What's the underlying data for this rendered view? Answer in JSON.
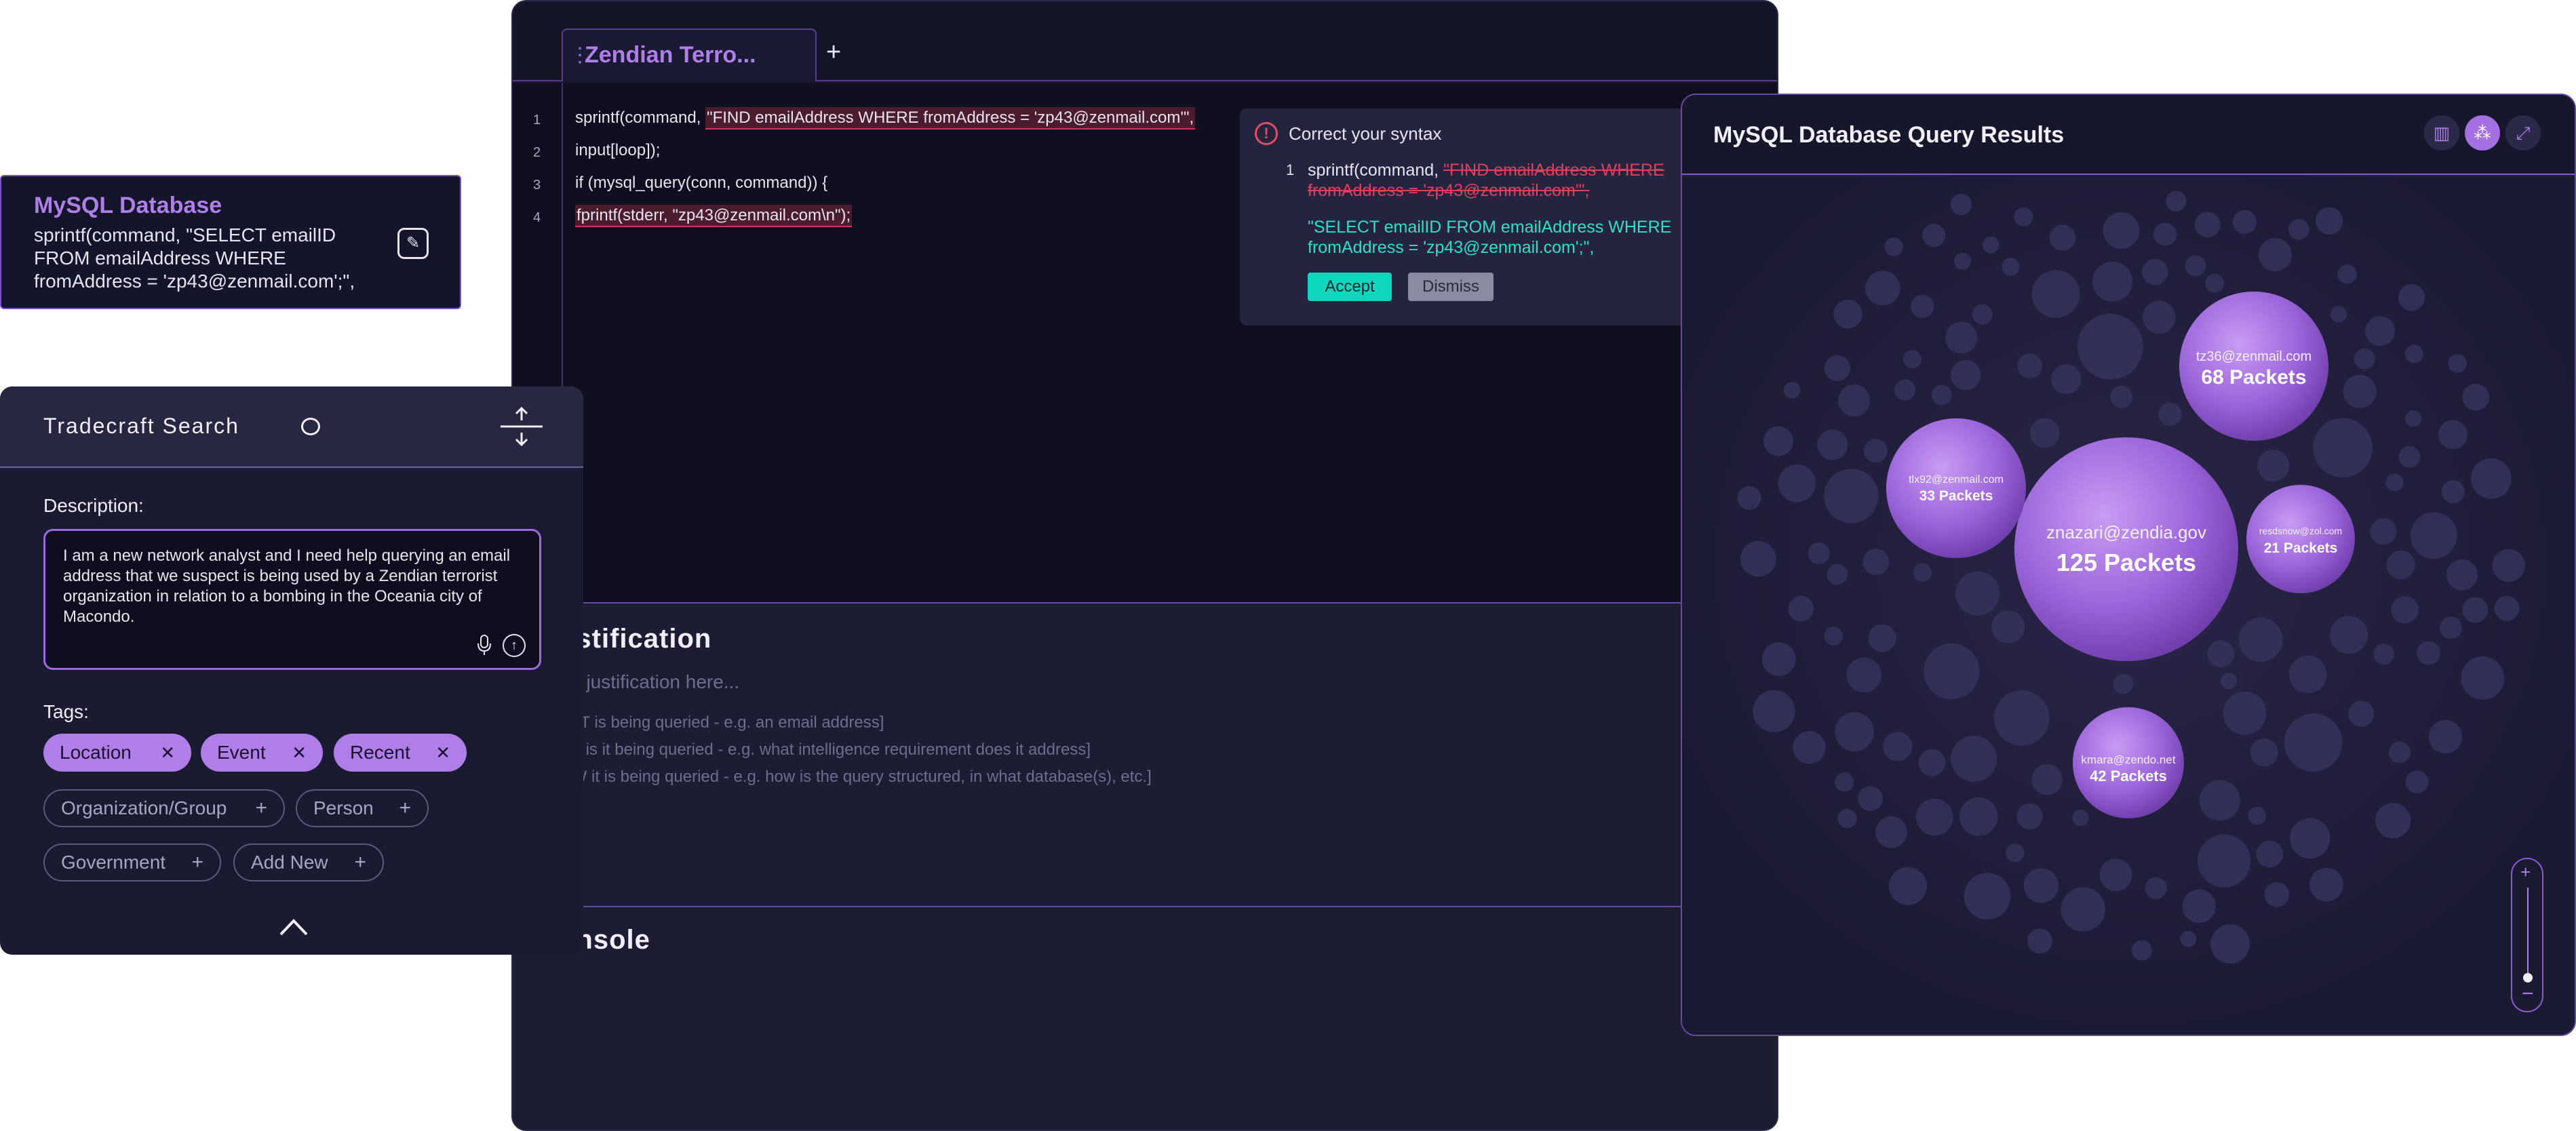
{
  "editor": {
    "tab_title": "Zendian Terro...",
    "add_tab": "+",
    "lines": [
      {
        "no": "1",
        "plain": "sprintf(command, ",
        "error": "\"FIND emailAddress WHERE fromAddress = 'zp43@zenmail.com'\","
      },
      {
        "no": "2",
        "plain": "input[loop]);",
        "error": ""
      },
      {
        "no": "3",
        "plain": "if (mysql_query(conn, command)) {",
        "error": ""
      },
      {
        "no": "4",
        "plain": "",
        "error": "fprintf(stderr, \"zp43@zenmail.com\\n\");"
      }
    ],
    "suggestion": {
      "title": "Correct your syntax",
      "line_no": "1",
      "line_prefix": "sprintf(command, ",
      "removed": "\"FIND emailAddress WHERE fromAddress = 'zp43@zenmail.com'\",",
      "added": "\"SELECT emailID FROM emailAddress WHERE fromAddress = 'zp43@zenmail.com';\",",
      "accept_label": "Accept",
      "dismiss_label": "Dismiss"
    },
    "justification": {
      "heading": "ustification",
      "placeholder": "ter justification here...",
      "hints": [
        "HAT is being queried - e.g. an email address]",
        "HY is it being queried - e.g. what intelligence requirement does it address]",
        "OW it is being queried - e.g. how is the query structured, in what database(s), etc.]"
      ]
    },
    "console_heading": "onsole"
  },
  "db_card": {
    "title": "MySQL Database",
    "query": "sprintf(command, \"SELECT emailID FROM emailAddress WHERE fromAddress = 'zp43@zenmail.com';\","
  },
  "search": {
    "title": "Tradecraft Search",
    "description_label": "Description:",
    "description": "I am a new network analyst and I need help querying an email address that we suspect is being used by a Zendian terrorist organization in relation to a bombing in the Oceania city of Macondo.",
    "tags_label": "Tags:",
    "selected_tags": [
      "Location",
      "Event",
      "Recent"
    ],
    "suggested_tags": [
      "Organization/Group",
      "Person",
      "Government",
      "Add New"
    ]
  },
  "results": {
    "title": "MySQL Database Query Results",
    "icons": [
      "bar-chart-icon",
      "bubble-chart-icon",
      "expand-icon"
    ],
    "bubbles": [
      {
        "email": "znazari@zendia.gov",
        "packets": "125 Packets"
      },
      {
        "email": "tz36@zenmail.com",
        "packets": "68 Packets"
      },
      {
        "email": "kmara@zendo.net",
        "packets": "42 Packets"
      },
      {
        "email": "tlx92@zenmail.com",
        "packets": "33 Packets"
      },
      {
        "email": "resdsnow@zol.com",
        "packets": "21 Packets"
      }
    ],
    "zoom_plus": "+",
    "zoom_minus": "−"
  },
  "colors": {
    "accent": "#b07ee8",
    "error": "#e0405a",
    "teal": "#10d6c0"
  }
}
